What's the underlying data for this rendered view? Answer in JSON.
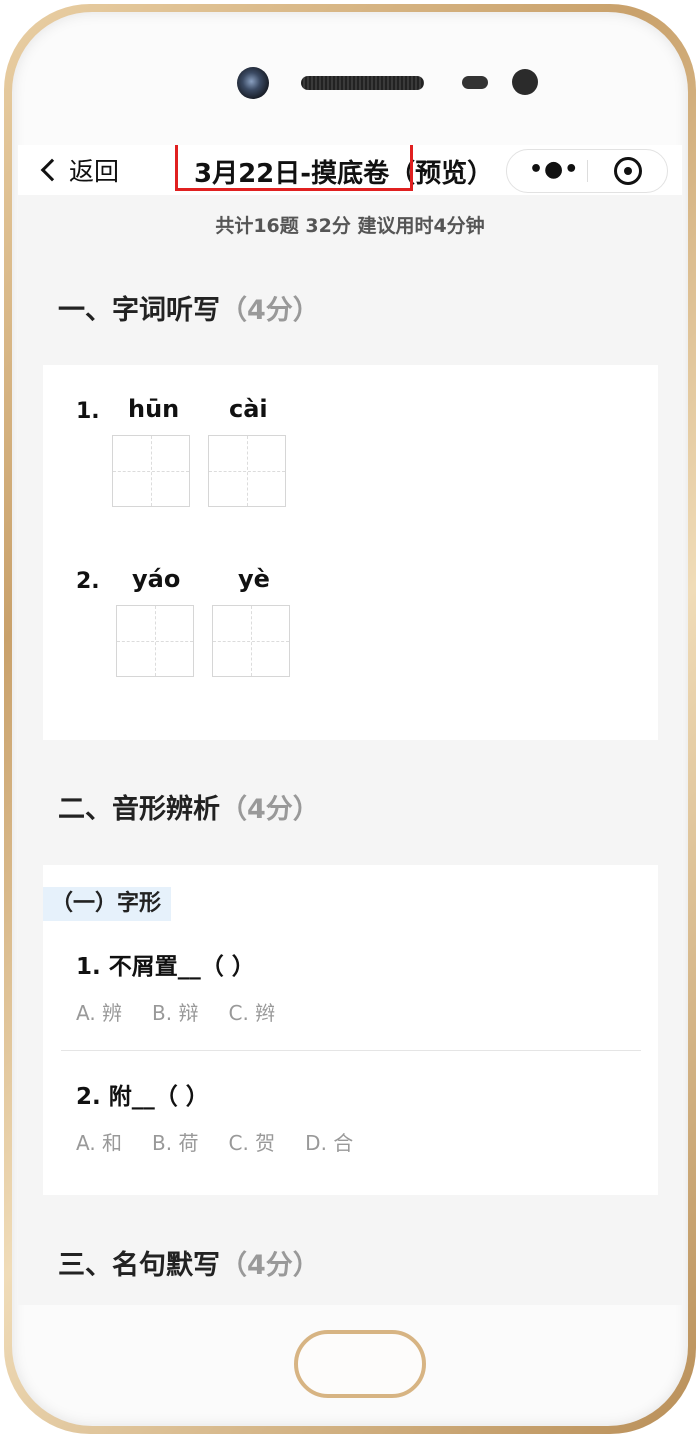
{
  "nav": {
    "back_label": "返回",
    "title": "3月22日-摸底卷（预览）",
    "more_icon": "more-dots-icon",
    "close_icon": "target-circle-icon"
  },
  "summary": "共计16题  32分  建议用时4分钟",
  "sections": [
    {
      "title": "一、字词听写",
      "score": "（4分）"
    },
    {
      "title": "二、音形辨析",
      "score": "（4分）"
    },
    {
      "title": "三、名句默写",
      "score": "（4分）"
    }
  ],
  "dictation": [
    {
      "num": "1.",
      "pinyin": [
        "hūn",
        "cài"
      ]
    },
    {
      "num": "2.",
      "pinyin": [
        "yáo",
        "yè"
      ]
    }
  ],
  "shape": {
    "subtitle": "（一）字形",
    "questions": [
      {
        "text": "1. 不屑置__（    ）",
        "options": [
          "A. 辨",
          "B. 辩",
          "C. 辫"
        ]
      },
      {
        "text": "2. 附__（    ）",
        "options": [
          "A. 和",
          "B. 荷",
          "C. 贺",
          "D. 合"
        ]
      }
    ]
  },
  "colors": {
    "highlight_border": "#e02020",
    "subtitle_bg": "#e6f1fb"
  }
}
